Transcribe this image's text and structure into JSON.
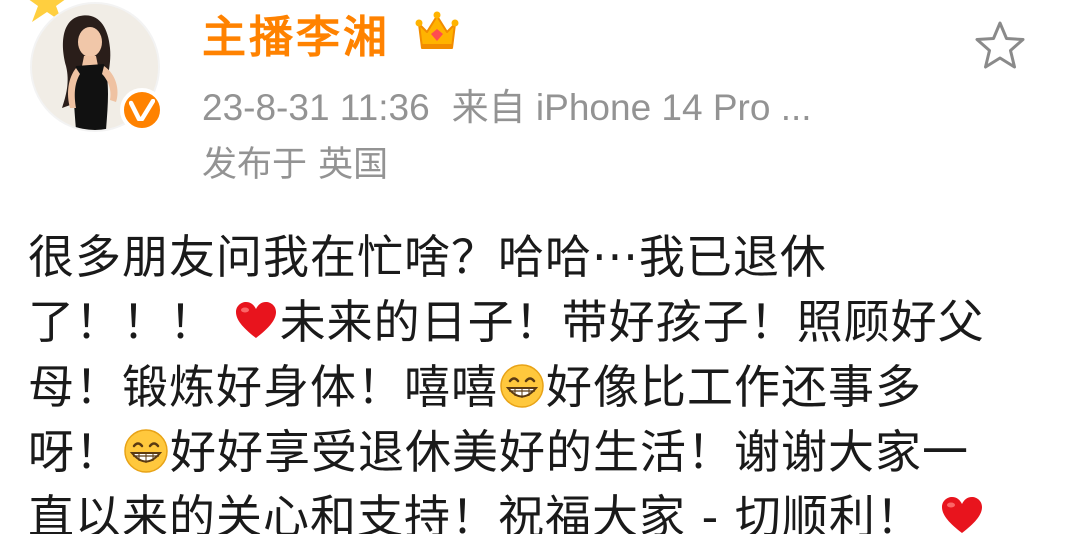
{
  "post": {
    "username": "主播李湘",
    "timestamp": "23-8-31 11:36",
    "source": "来自 iPhone 14 Pro ...",
    "location": "发布于 英国",
    "body_segments": [
      "很多朋友问我在忙啥？哈哈···我已退休",
      "了！！！",
      "未来的日子！带好孩子！照顾好父",
      "母！锻炼好身体！嘻嘻",
      "好像比工作还事多",
      "呀！",
      "好好享受退休美好的生活！谢谢大家一",
      "直以来的关心和支持！祝福大家 - 切顺利！"
    ]
  },
  "icons": {
    "crown": "crown-icon",
    "verify": "verified-v-icon",
    "favorite": "star-outline-icon",
    "heart": "red-heart-emoji",
    "grin": "grinning-face-emoji"
  },
  "colors": {
    "username": "#ff8200",
    "meta": "#939393",
    "body": "#1a1a1a",
    "verify_badge": "#ff8200",
    "heart": "#e8141d",
    "emoji_face": "#ffc83d"
  }
}
